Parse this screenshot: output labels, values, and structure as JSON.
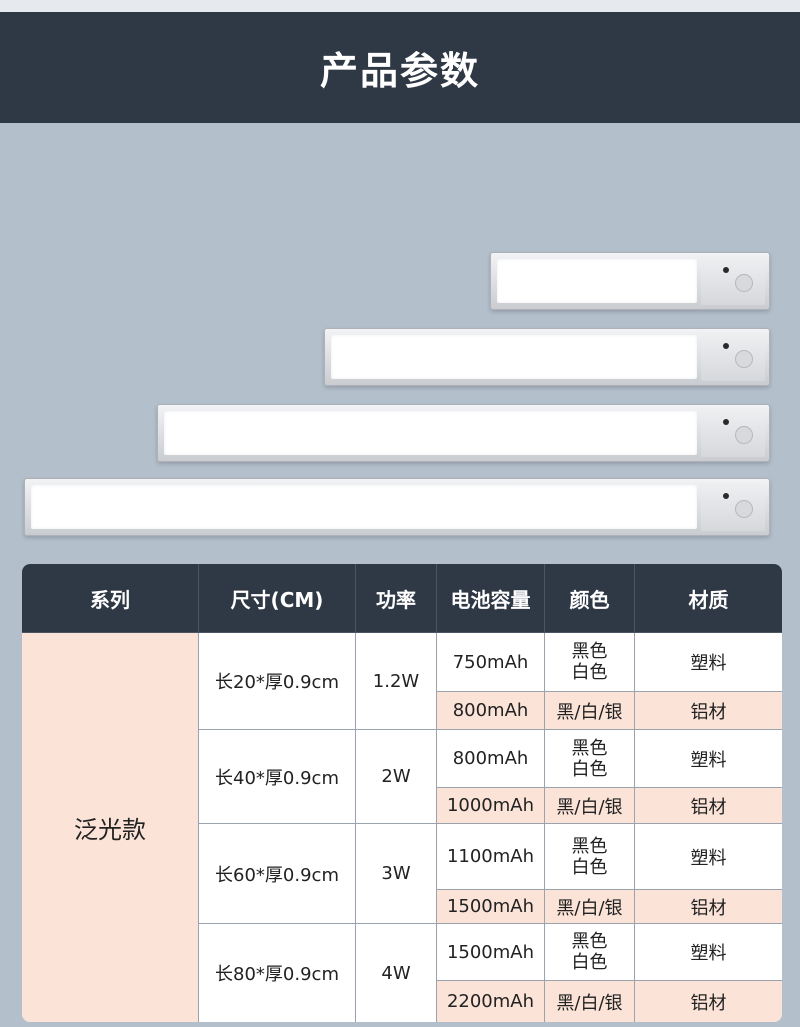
{
  "header": {
    "title": "产品参数"
  },
  "table": {
    "headers": [
      "系列",
      "尺寸(CM)",
      "功率",
      "电池容量",
      "颜色",
      "材质"
    ],
    "series_name": "泛光款",
    "groups": [
      {
        "size": "长20*厚0.9cm",
        "power": "1.2W",
        "rows": [
          {
            "battery": "750mAh",
            "color_lines": [
              "黑色",
              "白色"
            ],
            "material": "塑料"
          },
          {
            "battery": "800mAh",
            "color": "黑/白/银",
            "material": "铝材"
          }
        ]
      },
      {
        "size": "长40*厚0.9cm",
        "power": "2W",
        "rows": [
          {
            "battery": "800mAh",
            "color_lines": [
              "黑色",
              "白色"
            ],
            "material": "塑料"
          },
          {
            "battery": "1000mAh",
            "color": "黑/白/银",
            "material": "铝材"
          }
        ]
      },
      {
        "size": "长60*厚0.9cm",
        "power": "3W",
        "rows": [
          {
            "battery": "1100mAh",
            "color_lines": [
              "黑色",
              "白色"
            ],
            "material": "塑料"
          },
          {
            "battery": "1500mAh",
            "color": "黑/白/银",
            "material": "铝材"
          }
        ]
      },
      {
        "size": "长80*厚0.9cm",
        "power": "4W",
        "rows": [
          {
            "battery": "1500mAh",
            "color_lines": [
              "黑色",
              "白色"
            ],
            "material": "塑料"
          },
          {
            "battery": "2200mAh",
            "color": "黑/白/银",
            "material": "铝材"
          }
        ]
      }
    ]
  },
  "colors": {
    "header_bg": "#2f3845",
    "page_bg": "#b3bfcb",
    "peach": "#fbe3d8"
  }
}
